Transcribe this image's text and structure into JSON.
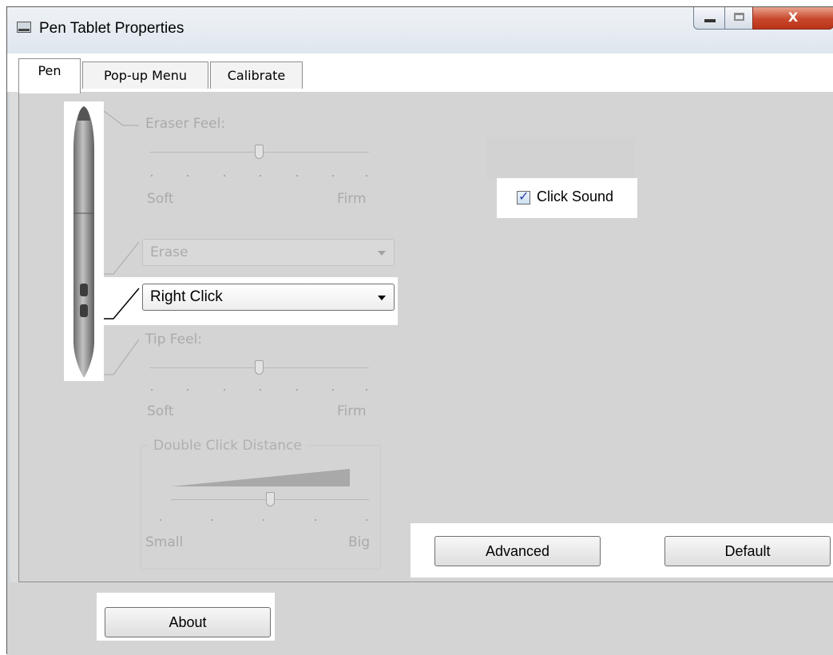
{
  "window": {
    "title": "Pen Tablet Properties",
    "close_glyph": "X"
  },
  "tabs": [
    {
      "label": "Pen",
      "selected": true
    },
    {
      "label": "Pop-up Menu",
      "selected": false
    },
    {
      "label": "Calibrate",
      "selected": false
    }
  ],
  "eraser_feel": {
    "label": "Eraser Feel:",
    "min_label": "Soft",
    "max_label": "Firm",
    "value_fraction": 0.5,
    "enabled": false
  },
  "upper_button": {
    "value": "Erase",
    "enabled": false
  },
  "lower_button": {
    "value": "Right Click",
    "enabled": true
  },
  "tip_feel": {
    "label": "Tip Feel:",
    "min_label": "Soft",
    "max_label": "Firm",
    "value_fraction": 0.5,
    "enabled": false
  },
  "double_click_distance": {
    "label": "Double Click Distance",
    "min_label": "Small",
    "max_label": "Big",
    "value_fraction": 0.5,
    "enabled": false
  },
  "click_sound": {
    "label": "Click Sound",
    "checked": true,
    "check_glyph": "✓"
  },
  "buttons": {
    "advanced": "Advanced",
    "default": "Default",
    "about": "About"
  },
  "colors": {
    "panel_bg": "#d4d4d4",
    "disabled_text": "#aaaaaa",
    "close_button": "#c8472c"
  }
}
